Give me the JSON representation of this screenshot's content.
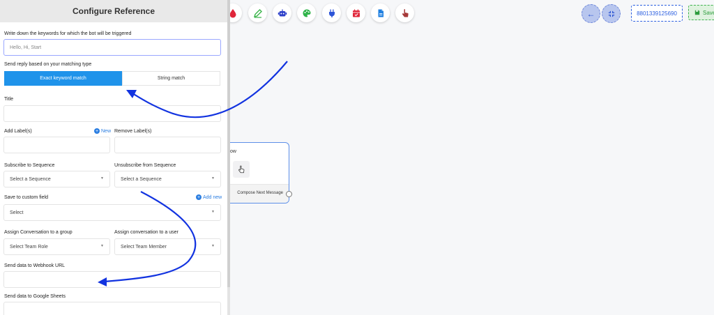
{
  "panel": {
    "title": "Configure Reference",
    "keywords": {
      "label": "Write down the keywords for which the bot will be triggered",
      "placeholder": "Hello, Hi, Start"
    },
    "reply_type": {
      "label": "Send reply based on your matching type",
      "options": [
        "Exact keyword match",
        "String match"
      ],
      "selected": "Exact keyword match"
    },
    "title_field": {
      "label": "Title",
      "value": ""
    },
    "add_labels": {
      "label": "Add Label(s)",
      "new_link": "New"
    },
    "remove_labels": {
      "label": "Remove Label(s)"
    },
    "subscribe": {
      "label": "Subscribe to Sequence",
      "value": "Select a Sequence"
    },
    "unsubscribe": {
      "label": "Unsubscribe from Sequence",
      "value": "Select a Sequence"
    },
    "custom_field": {
      "label": "Save to custom field",
      "add_link": "Add new",
      "value": "Select"
    },
    "assign_group": {
      "label": "Assign Conversation to a group",
      "value": "Select Team Role"
    },
    "assign_user": {
      "label": "Assign conversation to a user",
      "value": "Select Team Member"
    },
    "webhook": {
      "label": "Send data to Webhook URL",
      "value": ""
    },
    "sheets": {
      "label": "Send data to Google Sheets"
    }
  },
  "toolbar": {
    "icons": [
      {
        "name": "drop-icon",
        "color": "#e0263a"
      },
      {
        "name": "edit-icon",
        "color": "#3ab54a"
      },
      {
        "name": "robot-icon",
        "color": "#2b3ec9"
      },
      {
        "name": "palette-icon",
        "color": "#2fb34a"
      },
      {
        "name": "plug-icon",
        "color": "#2d55d8"
      },
      {
        "name": "calendar-icon",
        "color": "#e0263a"
      },
      {
        "name": "file-icon",
        "color": "#1f7fe0"
      },
      {
        "name": "hand-pointer-icon",
        "color": "#a63a3a"
      }
    ],
    "phone": "8801339125690",
    "save_label": "Save"
  },
  "node": {
    "title": "ow",
    "footer": "Compose Next Message"
  },
  "colors": {
    "primary": "#1f93ea",
    "annotation_arrow": "#1233e0"
  }
}
